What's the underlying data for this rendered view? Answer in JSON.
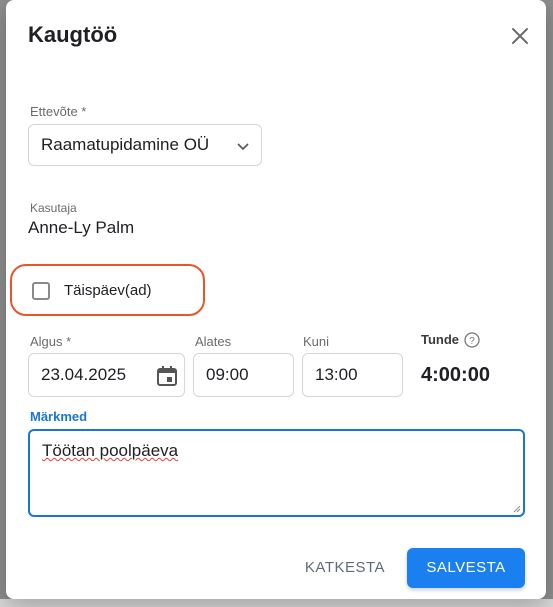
{
  "dialog": {
    "title": "Kaugtöö",
    "company": {
      "label": "Ettevõte *",
      "value": "Raamatupidamine OÜ"
    },
    "user": {
      "label": "Kasutaja",
      "value": "Anne-Ly Palm"
    },
    "full_day": {
      "label": "Täispäev(ad)",
      "checked": false
    },
    "start_date": {
      "label": "Algus *",
      "value": "23.04.2025"
    },
    "from": {
      "label": "Alates",
      "value": "09:00"
    },
    "to": {
      "label": "Kuni",
      "value": "13:00"
    },
    "hours": {
      "label": "Tunde",
      "value": "4:00:00"
    },
    "notes": {
      "label": "Märkmed",
      "value": "Töötan poolpäeva"
    },
    "buttons": {
      "cancel": "KATKESTA",
      "save": "SALVESTA"
    }
  },
  "colors": {
    "accent": "#1976d2",
    "primary_button": "#1a80f0",
    "highlight": "#e8552a"
  },
  "icons": {
    "close": "close-icon",
    "dropdown": "chevron-down-icon",
    "calendar": "calendar-icon",
    "help": "help-icon"
  }
}
